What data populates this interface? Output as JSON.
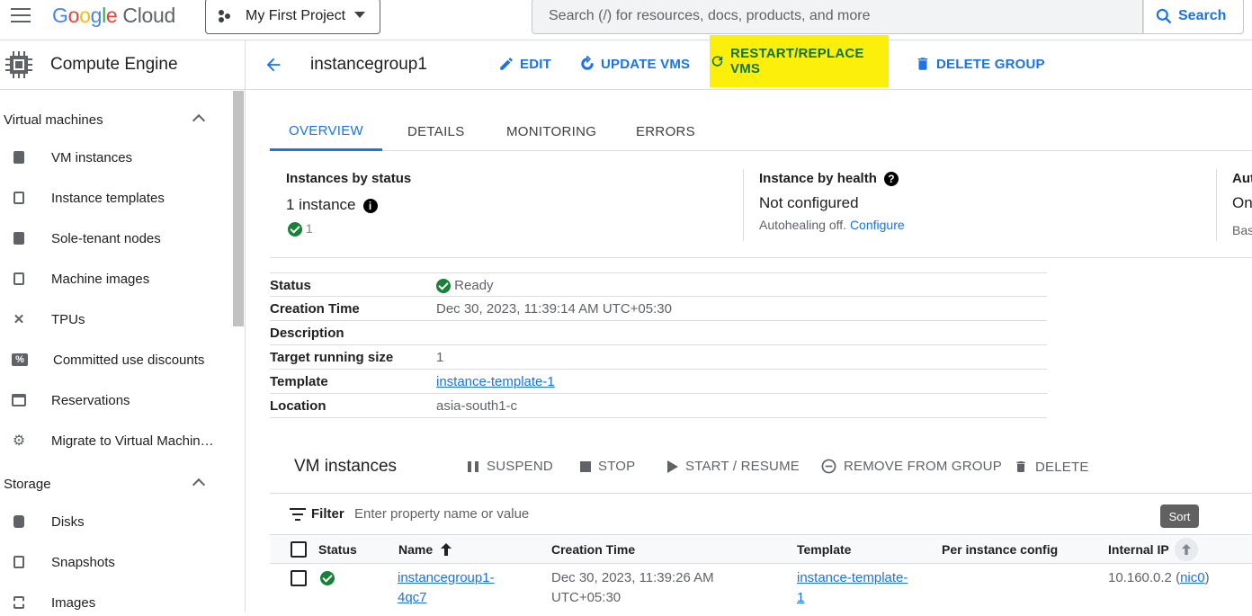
{
  "header": {
    "logo_google": "Google",
    "logo_cloud": "Cloud",
    "project": "My First Project",
    "search_placeholder": "Search (/) for resources, docs, products, and more",
    "search_button": "Search"
  },
  "sidebar": {
    "product": "Compute Engine",
    "sections": [
      {
        "label": "Virtual machines",
        "items": [
          "VM instances",
          "Instance templates",
          "Sole-tenant nodes",
          "Machine images",
          "TPUs",
          "Committed use discounts",
          "Reservations",
          "Migrate to Virtual Machin…"
        ]
      },
      {
        "label": "Storage",
        "items": [
          "Disks",
          "Snapshots",
          "Images"
        ]
      }
    ]
  },
  "actionbar": {
    "title": "instancegroup1",
    "edit": "EDIT",
    "update": "UPDATE VMS",
    "restart": "RESTART/REPLACE VMS",
    "delete": "DELETE GROUP"
  },
  "tabs": [
    "OVERVIEW",
    "DETAILS",
    "MONITORING",
    "ERRORS"
  ],
  "summary": {
    "status_label": "Instances by status",
    "instance_count": "1 instance",
    "ready_count": "1",
    "health_label": "Instance by health",
    "health_value": "Not configured",
    "autohealing": "Autohealing off.",
    "configure_link": "Configure",
    "auto_label": "Aut",
    "auto_value": "On",
    "auto_sub": "Bas"
  },
  "details": [
    {
      "key": "Status",
      "value": "Ready"
    },
    {
      "key": "Creation Time",
      "value": "Dec 30, 2023, 11:39:14 AM UTC+05:30"
    },
    {
      "key": "Description",
      "value": ""
    },
    {
      "key": "Target running size",
      "value": "1"
    },
    {
      "key": "Template",
      "value": "instance-template-1"
    },
    {
      "key": "Location",
      "value": "asia-south1-c"
    }
  ],
  "vm_section": {
    "title": "VM instances",
    "suspend": "SUSPEND",
    "stop": "STOP",
    "start": "START / RESUME",
    "remove": "REMOVE FROM GROUP",
    "delete": "DELETE",
    "filter_label": "Filter",
    "filter_placeholder": "Enter property name or value",
    "sort_tooltip": "Sort",
    "columns": [
      "Status",
      "Name",
      "Creation Time",
      "Template",
      "Per instance config",
      "Internal IP"
    ],
    "rows": [
      {
        "name_line1": "instancegroup1-",
        "name_line2": "4qc7",
        "created_line1": "Dec 30, 2023, 11:39:26 AM",
        "created_line2": "UTC+05:30",
        "template_line1": "instance-template-",
        "template_line2": "1",
        "ip": "10.160.0.2",
        "nic": "nic0"
      }
    ]
  },
  "colors": {
    "accent": "#1a73e8",
    "highlight": "#fcef09",
    "success": "#188038"
  }
}
